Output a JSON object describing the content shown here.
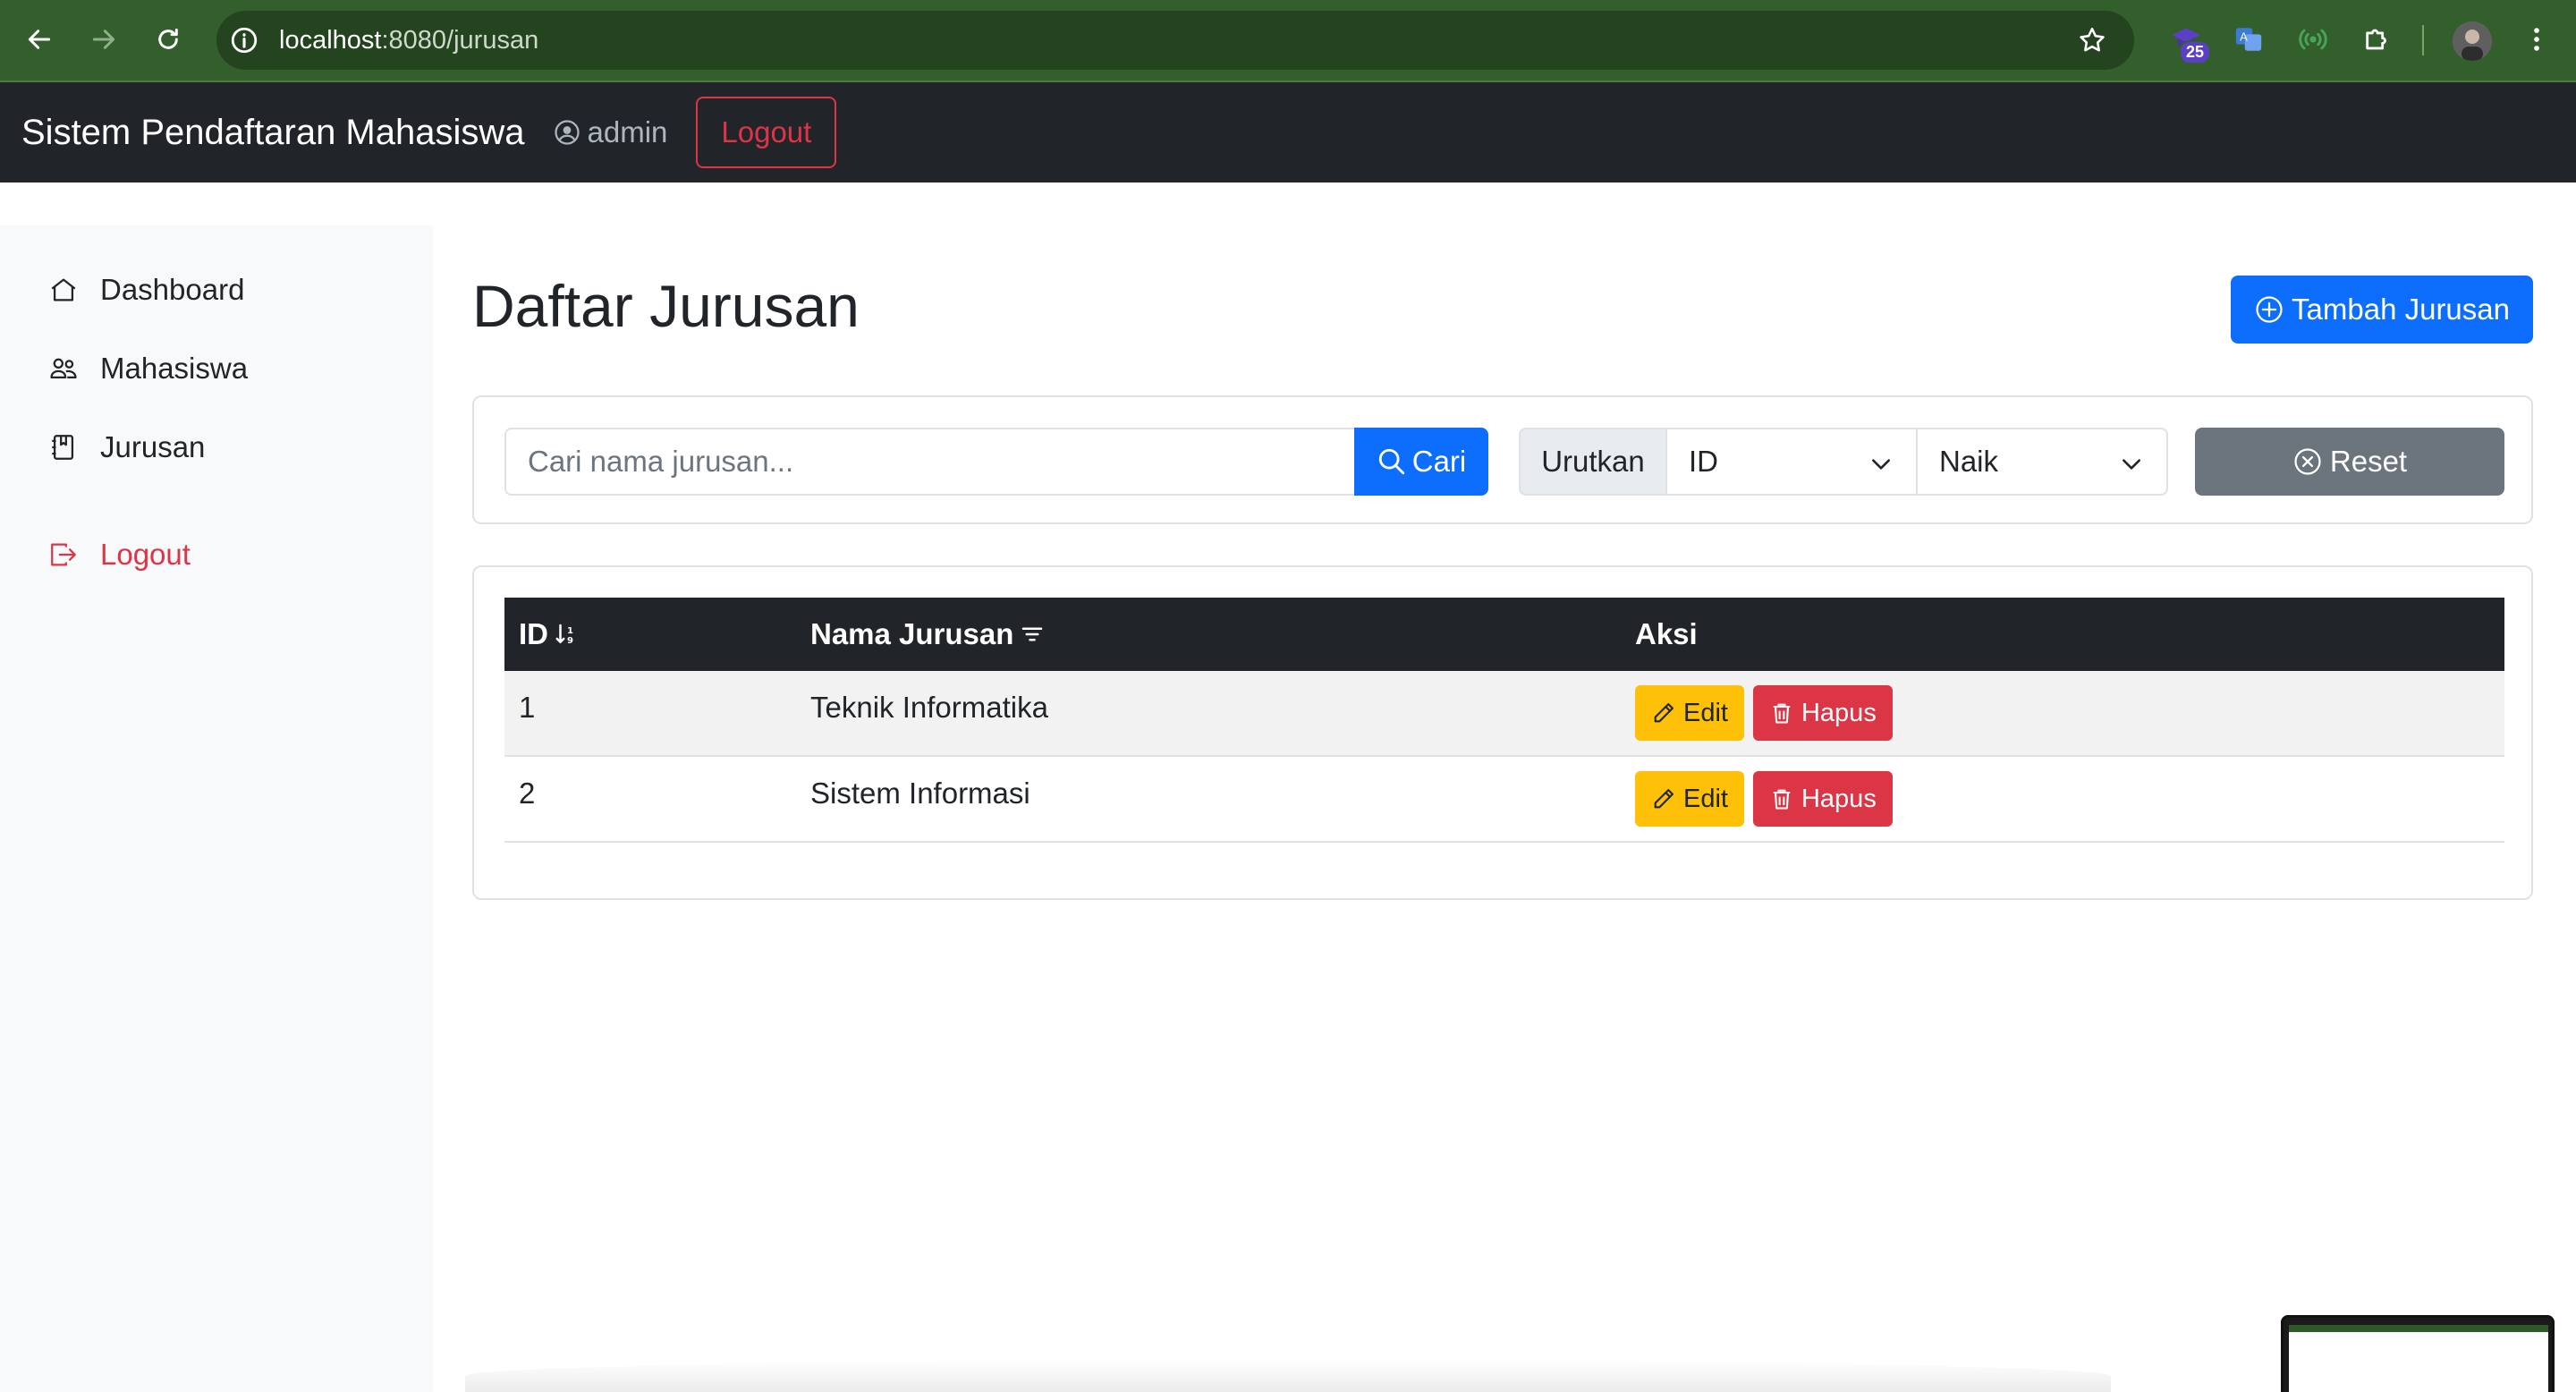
{
  "browser": {
    "url_host": "localhost",
    "url_path": ":8080/jurusan",
    "extension_badge": "25"
  },
  "navbar": {
    "brand": "Sistem Pendaftaran Mahasiswa",
    "username": "admin",
    "logout_label": "Logout"
  },
  "sidebar": {
    "items": [
      {
        "label": "Dashboard",
        "icon": "house-icon"
      },
      {
        "label": "Mahasiswa",
        "icon": "people-icon"
      },
      {
        "label": "Jurusan",
        "icon": "journal-icon"
      }
    ],
    "logout_label": "Logout"
  },
  "main": {
    "title": "Daftar Jurusan",
    "add_button": "Tambah Jurusan",
    "search": {
      "placeholder": "Cari nama jurusan...",
      "button": "Cari"
    },
    "sort": {
      "label": "Urutkan",
      "field": "ID",
      "order": "Naik"
    },
    "reset_button": "Reset",
    "table": {
      "headers": [
        "ID",
        "Nama Jurusan",
        "Aksi"
      ],
      "rows": [
        {
          "id": "1",
          "nama": "Teknik Informatika"
        },
        {
          "id": "2",
          "nama": "Sistem Informasi"
        }
      ],
      "edit_label": "Edit",
      "delete_label": "Hapus"
    }
  },
  "colors": {
    "primary": "#0d6efd",
    "danger": "#dc3545",
    "warning": "#ffc107",
    "secondary": "#6c757d",
    "dark": "#212529",
    "chrome": "#335f2c"
  }
}
